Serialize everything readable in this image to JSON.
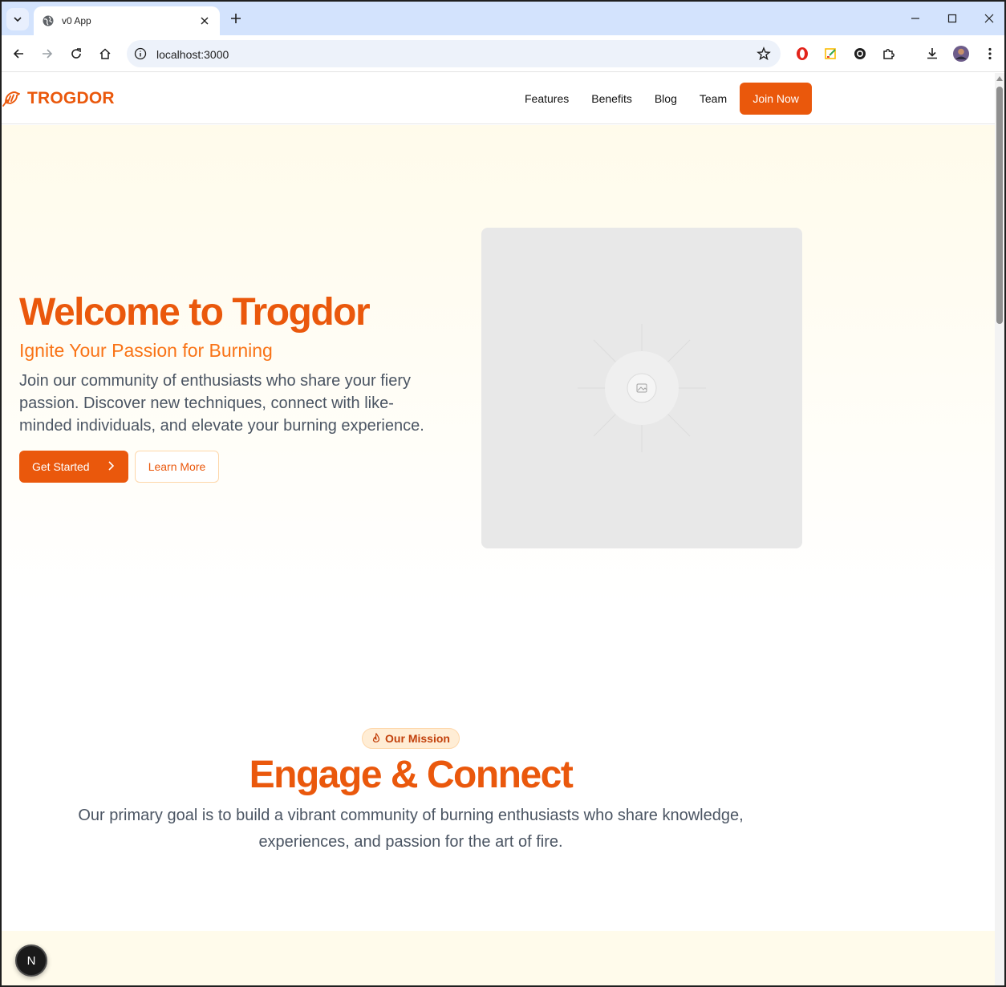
{
  "browser": {
    "tab_title": "v0 App",
    "url": "localhost:3000"
  },
  "header": {
    "brand": "TROGDOR",
    "nav": [
      "Features",
      "Benefits",
      "Blog",
      "Team"
    ],
    "cta": "Join Now"
  },
  "hero": {
    "title": "Welcome to Trogdor",
    "subtitle": "Ignite Your Passion for Burning",
    "description": "Join our community of enthusiasts who share your fiery passion. Discover new techniques, connect with like-minded individuals, and elevate your burning experience.",
    "primary_button": "Get Started",
    "secondary_button": "Learn More"
  },
  "mission": {
    "badge": "Our Mission",
    "title": "Engage & Connect",
    "description": "Our primary goal is to build a vibrant community of burning enthusiasts who share knowledge, experiences, and passion for the art of fire."
  },
  "dev_badge": "N",
  "colors": {
    "accent": "#ea580c",
    "accent_light": "#f97316",
    "hero_bg": "#fffbeb",
    "text_muted": "#4b5563"
  }
}
